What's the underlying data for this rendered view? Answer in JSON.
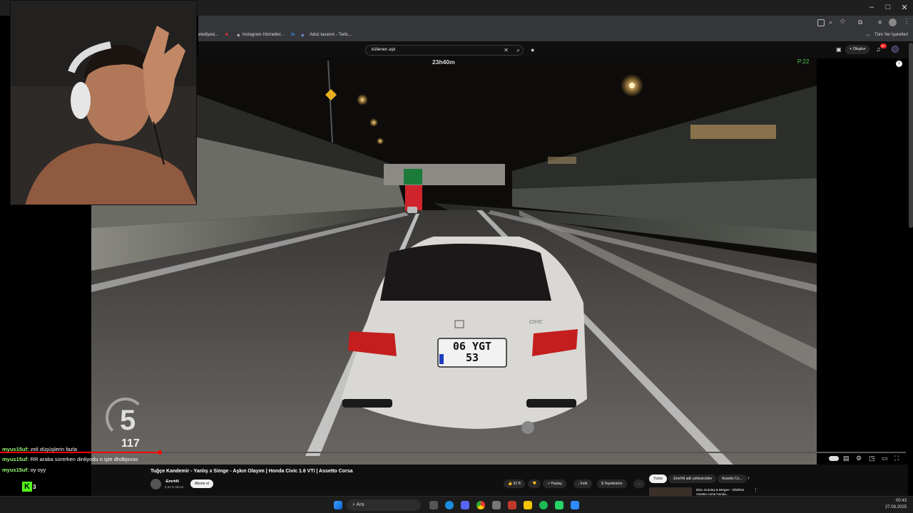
{
  "browser": {
    "bookmarks": [
      "eledlyesi...",
      "Instagram Hizmetler...",
      "Adoz tasarım - Twitc...",
      "Tüm Yer İşaretleri"
    ],
    "window_controls": [
      "–",
      "□",
      "✕"
    ]
  },
  "youtube": {
    "search_value": "küllenen aşk",
    "create_label": "Oluştur",
    "notification_count": "9+",
    "video_title": "Tuğçe Kandemir - Yanlış x Simge - Aşkın Olayım | Honda Civic 1.6 VTi | Assetto Corsa",
    "channel_name": "-EmrhN",
    "subscribers": "5,82 B abone",
    "subscribe_label": "Abone ol",
    "likes": "62 B",
    "share_label": "Paylaş",
    "download_label": "İndir",
    "thanks_label": "Teşekkürler",
    "more_label": "...",
    "chips": [
      "Tümü",
      "-EmrhN adlı yükleyiciden",
      "Assetto Co..."
    ],
    "recommended_title": "Ebru Gündeş & Bergen - Sihirlisin Assetto corsa Honda..."
  },
  "game": {
    "clock": "23h40m",
    "position": "P:22",
    "gear": "5",
    "speed": "117",
    "plate_line1": "06 YGT",
    "plate_line2": "53",
    "car_badge": "CIVIC"
  },
  "overlay": {
    "chat": [
      {
        "user": "myus15uf:",
        "text": " zeli düşüşlerin fazla"
      },
      {
        "user": "myus15uf:",
        "text": " RR araba sürerken dinliyodu o işte dhdbjsvso"
      },
      {
        "user": "myus15uf:",
        "text": " oy oyy"
      }
    ],
    "kick_logo": "K",
    "kick_viewers": "3"
  },
  "taskbar": {
    "search_placeholder": "Ara",
    "time": "00:43",
    "date": "27.08.2025"
  },
  "colors": {
    "accent_red": "#ff0000",
    "chat_user": "#9aff7a",
    "kick_green": "#53fc18"
  }
}
